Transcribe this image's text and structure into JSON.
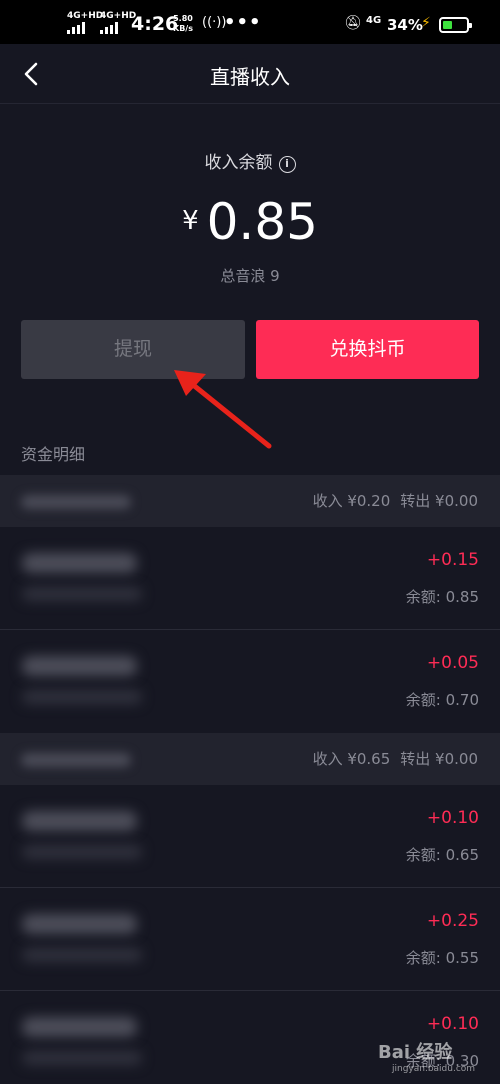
{
  "status_bar": {
    "net1": "4G+HD",
    "net2": "4G+HD",
    "time": "4:26",
    "speed_value": "5.80",
    "speed_unit": "KB/s",
    "overflow": "•••",
    "net3": "4G",
    "battery_pct": "34%",
    "battery_level": 0.34,
    "battery_color": "#3ee23e"
  },
  "nav": {
    "title": "直播收入"
  },
  "balance": {
    "label": "收入余额",
    "currency": "¥",
    "amount": "0.85",
    "total_label": "总音浪 9"
  },
  "buttons": {
    "withdraw": "提现",
    "exchange": "兑换抖币"
  },
  "detail": {
    "title": "资金明细",
    "months": [
      {
        "summary_income": "收入 ¥0.20",
        "summary_out": "转出 ¥0.00",
        "rows": [
          {
            "amount": "+0.15",
            "balance": "余额: 0.85"
          },
          {
            "amount": "+0.05",
            "balance": "余额: 0.70"
          }
        ]
      },
      {
        "summary_income": "收入 ¥0.65",
        "summary_out": "转出 ¥0.00",
        "rows": [
          {
            "amount": "+0.10",
            "balance": "余额: 0.65"
          },
          {
            "amount": "+0.25",
            "balance": "余额: 0.55"
          },
          {
            "amount": "+0.10",
            "balance": "余额: 0.30"
          }
        ]
      }
    ]
  },
  "colors": {
    "accent": "#fe2c55",
    "background": "#161722",
    "arrow": "#e8231b"
  },
  "watermark": {
    "brand": "Bai 经验",
    "url": "jingyan.baidu.com"
  }
}
